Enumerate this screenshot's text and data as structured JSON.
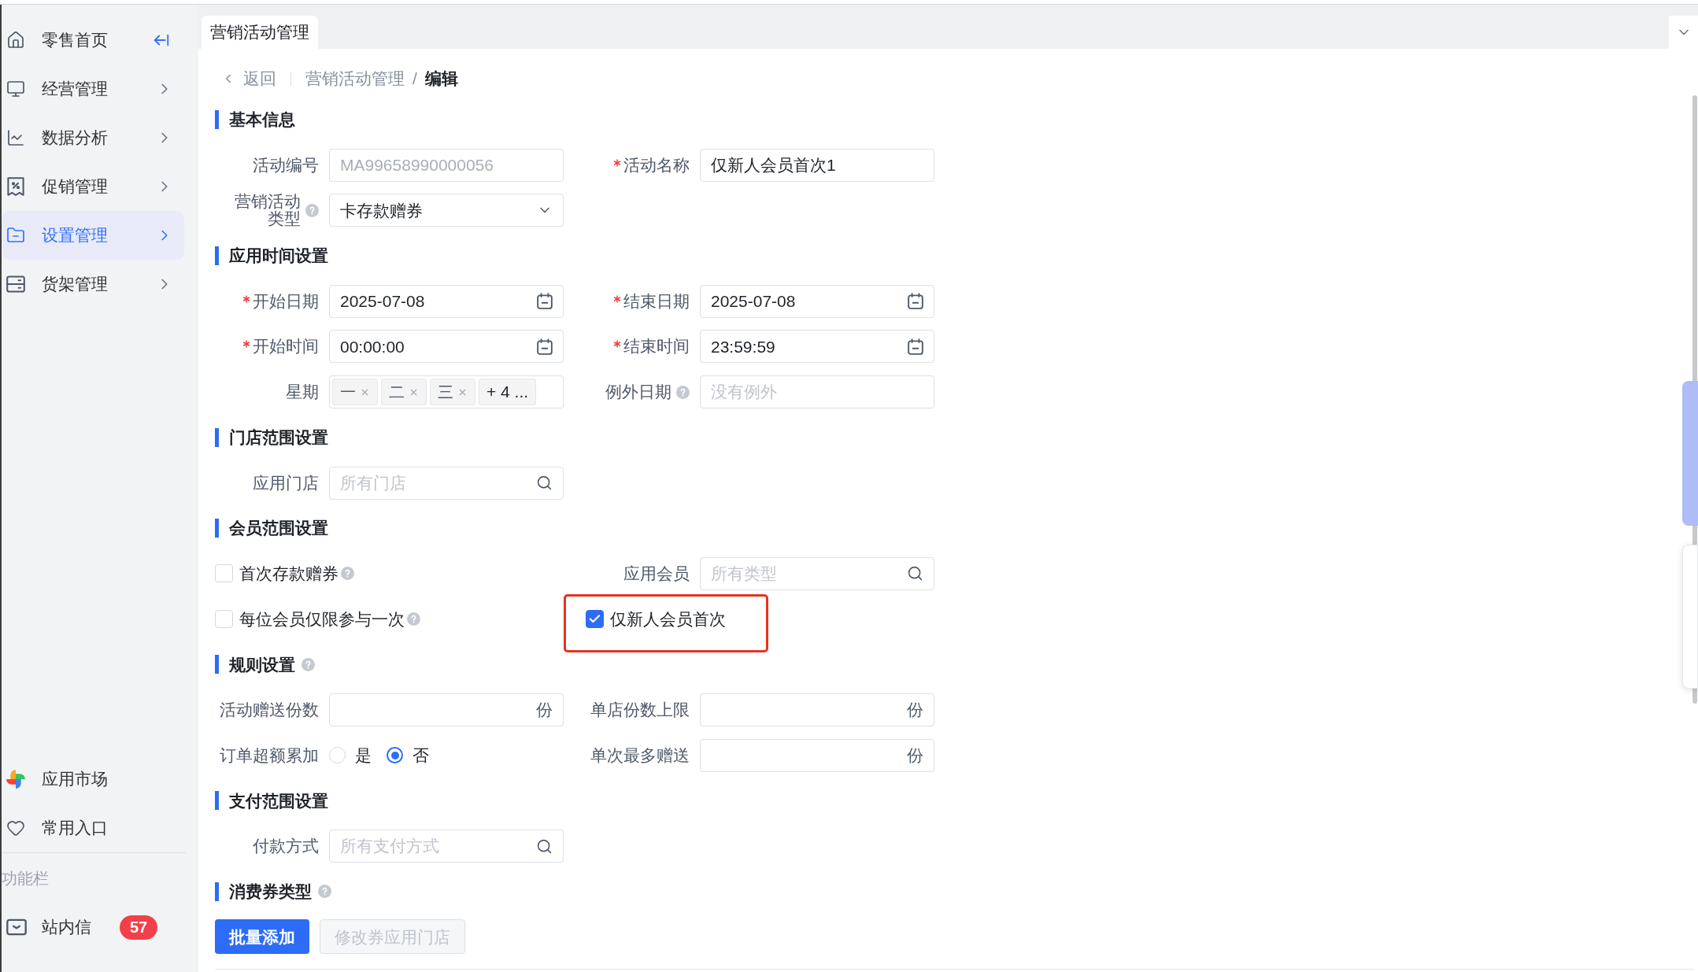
{
  "sidebar": {
    "nav_items": [
      {
        "label": "零售首页",
        "selected": false,
        "expandable": false
      },
      {
        "label": "经营管理",
        "selected": false,
        "expandable": true
      },
      {
        "label": "数据分析",
        "selected": false,
        "expandable": true
      },
      {
        "label": "促销管理",
        "selected": false,
        "expandable": true
      },
      {
        "label": "设置管理",
        "selected": true,
        "expandable": true
      },
      {
        "label": "货架管理",
        "selected": false,
        "expandable": true
      }
    ],
    "quick_items": [
      {
        "label": "应用市场"
      },
      {
        "label": "常用入口"
      }
    ],
    "tools_heading": "功能栏",
    "tool_items": [
      {
        "label": "站内信",
        "badge": "57"
      }
    ]
  },
  "tabs": [
    {
      "label": "营销活动管理",
      "selected": true
    }
  ],
  "breadcrumb": {
    "back": "返回",
    "items": [
      "营销活动管理",
      "编辑"
    ],
    "separator": "/"
  },
  "sections": [
    {
      "title": "基本信息",
      "help": false,
      "rows": [
        [
          {
            "kind": "text",
            "label": "活动编号",
            "required": false,
            "help": false,
            "value": "MA99658990000056",
            "disabled": true
          },
          {
            "kind": "text",
            "label": "活动名称",
            "required": true,
            "help": false,
            "value": "仅新人会员首次1",
            "disabled": false
          }
        ],
        [
          {
            "kind": "select",
            "label": "营销活动类型",
            "required": false,
            "help": true,
            "value": "卡存款赠券"
          }
        ]
      ]
    },
    {
      "title": "应用时间设置",
      "help": false,
      "rows": [
        [
          {
            "kind": "date",
            "label": "开始日期",
            "required": true,
            "help": false,
            "value": "2025-07-08"
          },
          {
            "kind": "date",
            "label": "结束日期",
            "required": true,
            "help": false,
            "value": "2025-07-08"
          }
        ],
        [
          {
            "kind": "date",
            "label": "开始时间",
            "required": true,
            "help": false,
            "value": "00:00:00"
          },
          {
            "kind": "date",
            "label": "结束时间",
            "required": true,
            "help": false,
            "value": "23:59:59"
          }
        ],
        [
          {
            "kind": "tags",
            "label": "星期",
            "required": false,
            "help": false,
            "tags": [
              "一",
              "二",
              "三"
            ],
            "more": "+ 4 ..."
          },
          {
            "kind": "text",
            "label": "例外日期",
            "required": false,
            "help": true,
            "placeholder": "没有例外"
          }
        ]
      ]
    },
    {
      "title": "门店范围设置",
      "help": false,
      "rows": [
        [
          {
            "kind": "search",
            "label": "应用门店",
            "required": false,
            "help": false,
            "placeholder": "所有门店"
          }
        ]
      ]
    },
    {
      "title": "会员范围设置",
      "help": false,
      "rows": [
        [
          {
            "kind": "checkbox",
            "label": "首次存款赠券",
            "help": true,
            "checked": false,
            "highlighted": false
          },
          {
            "kind": "search",
            "label": "应用会员",
            "required": false,
            "help": false,
            "placeholder": "所有类型"
          }
        ],
        [
          {
            "kind": "checkbox",
            "label": "每位会员仅限参与一次",
            "help": true,
            "checked": false,
            "highlighted": false
          },
          {
            "kind": "checkbox",
            "label": "仅新人会员首次",
            "help": false,
            "checked": true,
            "highlighted": true
          }
        ]
      ]
    },
    {
      "title": "规则设置",
      "help": true,
      "rows": [
        [
          {
            "kind": "unit",
            "label": "活动赠送份数",
            "required": false,
            "help": false,
            "unit": "份"
          },
          {
            "kind": "unit",
            "label": "单店份数上限",
            "required": false,
            "help": false,
            "unit": "份"
          }
        ],
        [
          {
            "kind": "radio",
            "label": "订单超额累加",
            "required": false,
            "help": false,
            "options": [
              {
                "label": "是",
                "selected": false
              },
              {
                "label": "否",
                "selected": true
              }
            ]
          },
          {
            "kind": "unit",
            "label": "单次最多赠送",
            "required": false,
            "help": false,
            "unit": "份"
          }
        ]
      ]
    },
    {
      "title": "支付范围设置",
      "help": false,
      "rows": [
        [
          {
            "kind": "search",
            "label": "付款方式",
            "required": false,
            "help": false,
            "placeholder": "所有支付方式"
          }
        ]
      ]
    },
    {
      "title": "消费券类型",
      "help": true,
      "buttons": [
        {
          "label": "批量添加",
          "kind": "primary",
          "disabled": false
        },
        {
          "label": "修改券应用门店",
          "kind": "default",
          "disabled": true
        }
      ]
    }
  ]
}
